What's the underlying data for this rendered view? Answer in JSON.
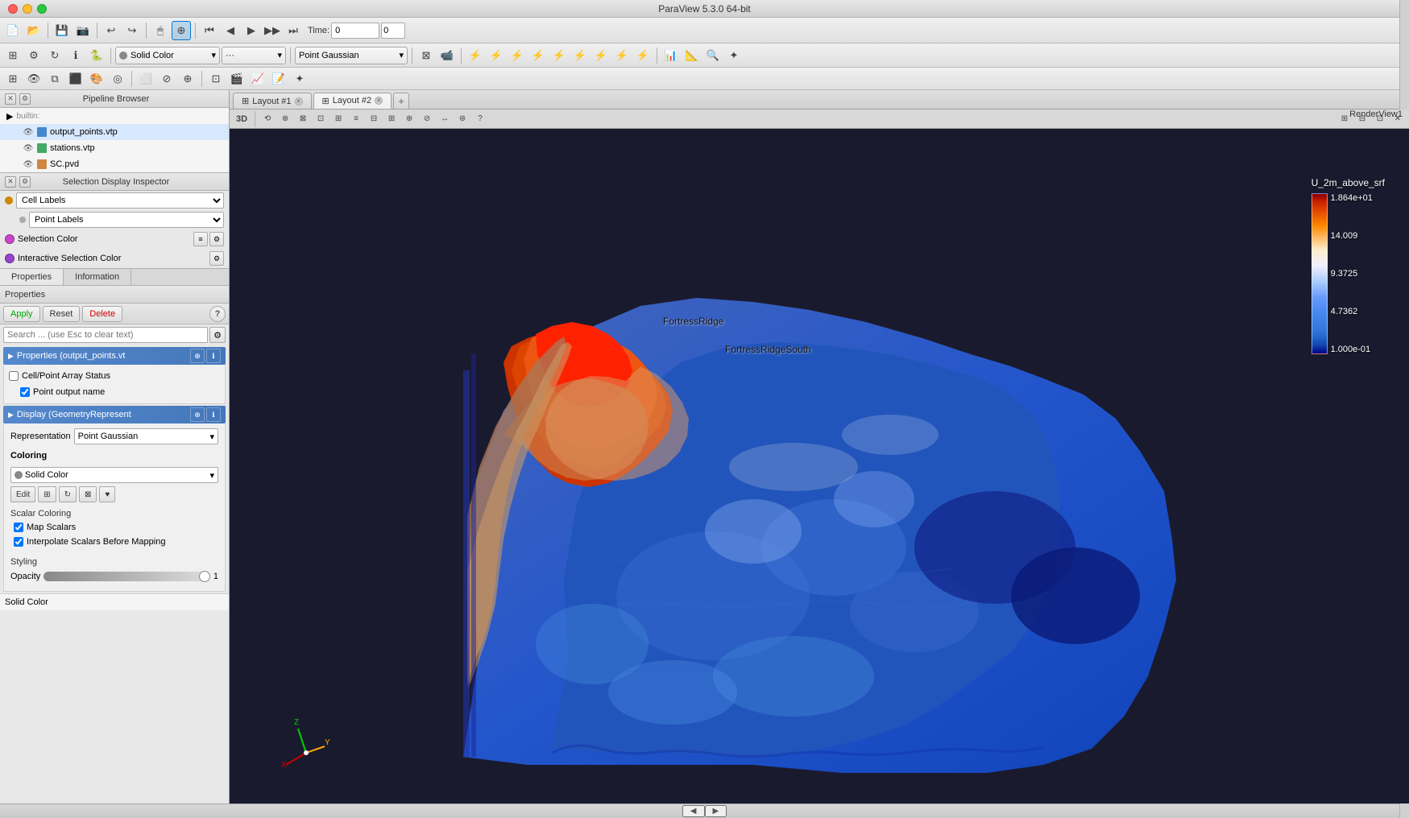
{
  "app": {
    "title": "ParaView 5.3.0 64-bit"
  },
  "titlebar": {
    "title": "ParaView 5.3.0 64-bit"
  },
  "toolbar1": {
    "time_label": "Time:",
    "time_value": "0",
    "time_num_value": "0",
    "color_dropdown": "Solid Color",
    "repr_dropdown": "Point Gaussian"
  },
  "pipeline": {
    "title": "Pipeline Browser",
    "items": [
      {
        "label": "builtin:",
        "indent": 0,
        "type": "root"
      },
      {
        "label": "output_points.vtp",
        "indent": 1,
        "type": "vtp",
        "active": true
      },
      {
        "label": "stations.vtp",
        "indent": 1,
        "type": "vtp"
      },
      {
        "label": "SC.pvd",
        "indent": 1,
        "type": "pvd"
      }
    ]
  },
  "selection_display": {
    "title": "Selection Display Inspector",
    "cell_labels": "Cell Labels",
    "point_labels": "Point Labels",
    "selection_color_label": "Selection Color",
    "interactive_color_label": "Interactive Selection Color"
  },
  "tabs": {
    "properties": "Properties",
    "information": "Information"
  },
  "properties_panel": {
    "title": "Properties",
    "apply_btn": "Apply",
    "reset_btn": "Reset",
    "delete_btn": "Delete",
    "help_btn": "?",
    "search_placeholder": "Search ... (use Esc to clear text)",
    "section_output": "Properties (output_points.vt",
    "section_display": "Display (GeometryRepresent",
    "cell_point_label": "Cell/Point Array Status",
    "point_output_name": "Point output name",
    "representation_label": "Representation",
    "representation_value": "Point Gaussian",
    "coloring_label": "Coloring",
    "solid_color_label": "Solid Color",
    "edit_btn": "Edit",
    "scalar_coloring_label": "Scalar Coloring",
    "map_scalars": "Map Scalars",
    "interpolate_scalars": "Interpolate Scalars Before Mapping",
    "styling_label": "Styling",
    "opacity_label": "Opacity",
    "opacity_value": "1",
    "bottom_solid_color": "Solid Color"
  },
  "layout_tabs": [
    {
      "label": "Layout #1",
      "active": false
    },
    {
      "label": "Layout #2",
      "active": true
    }
  ],
  "render_view": {
    "label": "RenderView1",
    "label_3d": "3D"
  },
  "viewport": {
    "label1": "FortressRidge",
    "label2": "FortressRidgeSouth"
  },
  "color_legend": {
    "title": "U_2m_above_srf",
    "max": "1.864e+01",
    "v1": "14.009",
    "v2": "9.3725",
    "v3": "4.7362",
    "min": "1.000e-01"
  },
  "bottom_bar": {
    "label": "◀ ▶"
  }
}
